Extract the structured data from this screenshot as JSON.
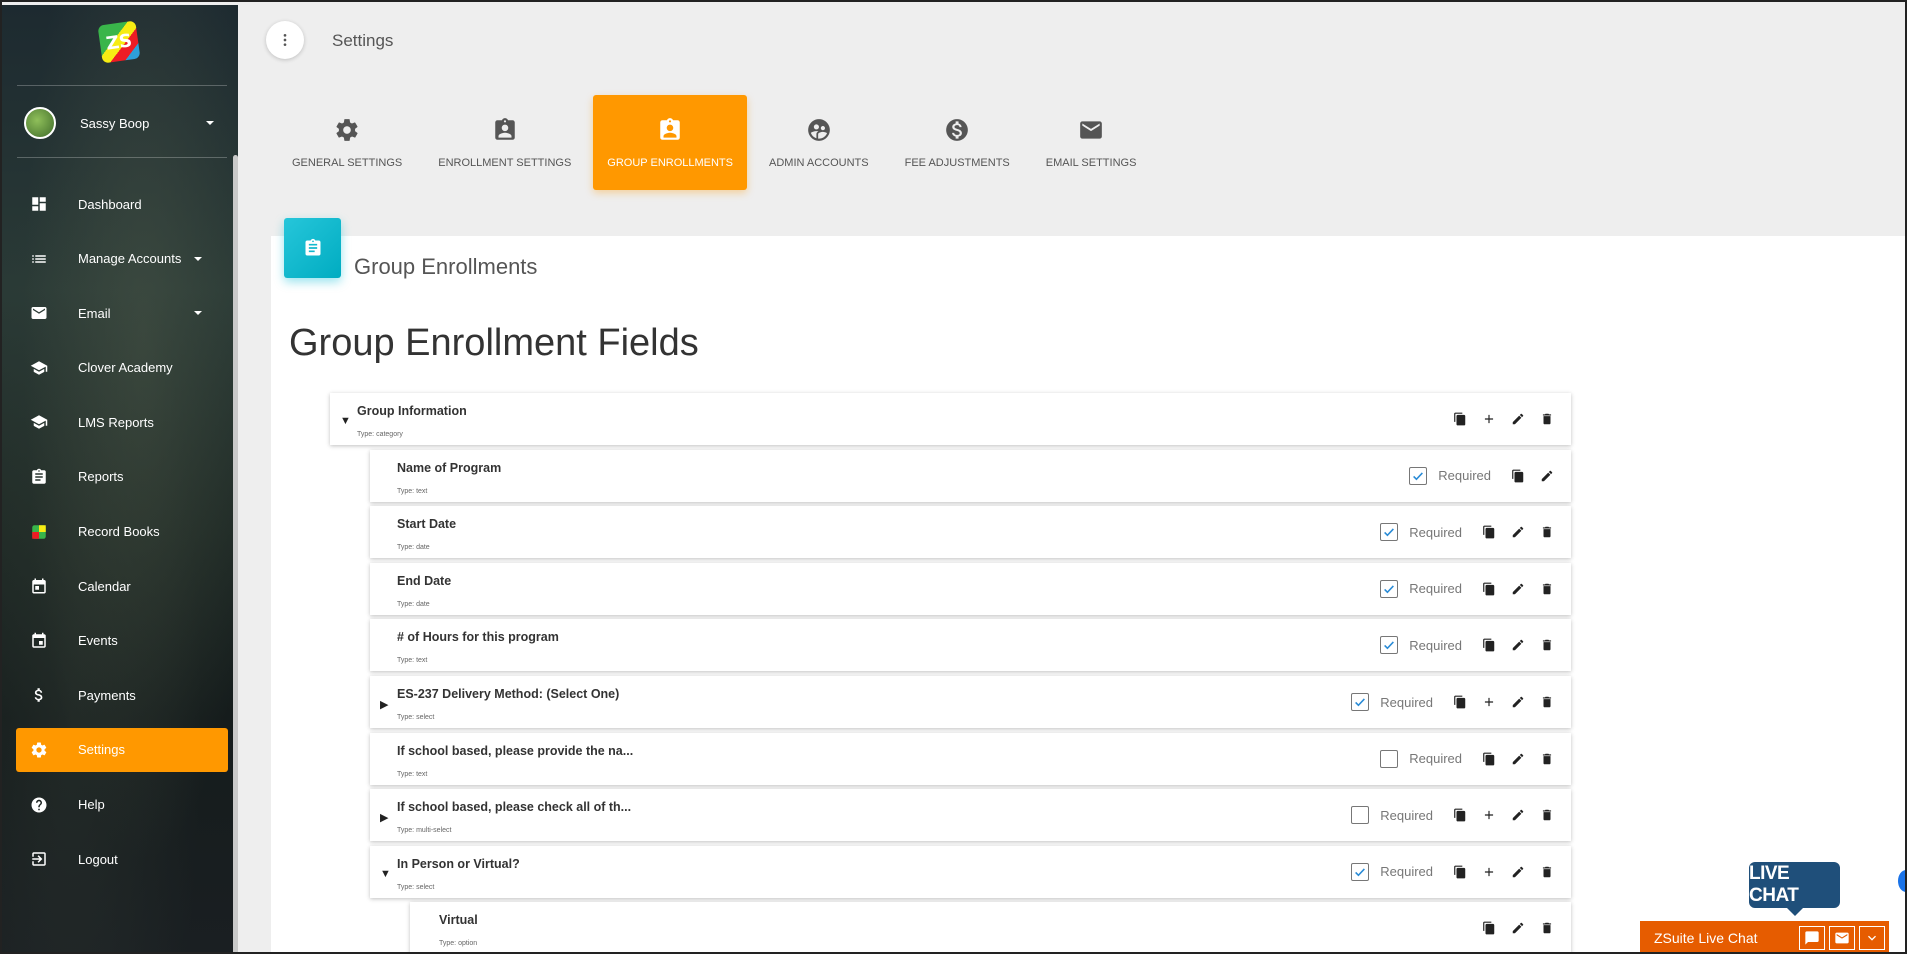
{
  "sidebar": {
    "logo_text": "ZS",
    "user_name": "Sassy Boop",
    "items": [
      {
        "label": "Dashboard",
        "icon": "dashboard-icon",
        "caret": false,
        "active": false
      },
      {
        "label": "Manage Accounts",
        "icon": "list-icon",
        "caret": true,
        "active": false
      },
      {
        "label": "Email",
        "icon": "mail-icon",
        "caret": true,
        "active": false
      },
      {
        "label": "Clover Academy",
        "icon": "school-icon",
        "caret": false,
        "active": false
      },
      {
        "label": "LMS Reports",
        "icon": "school-icon",
        "caret": false,
        "active": false
      },
      {
        "label": "Reports",
        "icon": "clipboard-icon",
        "caret": false,
        "active": false
      },
      {
        "label": "Record Books",
        "icon": "zs-logo-icon",
        "caret": false,
        "active": false
      },
      {
        "label": "Calendar",
        "icon": "calendar-icon",
        "caret": false,
        "active": false
      },
      {
        "label": "Events",
        "icon": "event-icon",
        "caret": false,
        "active": false
      },
      {
        "label": "Payments",
        "icon": "dollar-icon",
        "caret": false,
        "active": false
      },
      {
        "label": "Settings",
        "icon": "gear-icon",
        "caret": false,
        "active": true
      },
      {
        "label": "Help",
        "icon": "help-icon",
        "caret": false,
        "active": false
      },
      {
        "label": "Logout",
        "icon": "logout-icon",
        "caret": false,
        "active": false
      }
    ]
  },
  "header": {
    "title": "Settings",
    "tabs": [
      {
        "label": "GENERAL SETTINGS",
        "icon": "gear-icon",
        "active": false
      },
      {
        "label": "ENROLLMENT SETTINGS",
        "icon": "badge-icon",
        "active": false
      },
      {
        "label": "GROUP ENROLLMENTS",
        "icon": "badge-icon",
        "active": true
      },
      {
        "label": "ADMIN ACCOUNTS",
        "icon": "group-icon",
        "active": false
      },
      {
        "label": "FEE ADJUSTMENTS",
        "icon": "dollar-circle-icon",
        "active": false
      },
      {
        "label": "EMAIL SETTINGS",
        "icon": "mail-icon",
        "active": false
      }
    ]
  },
  "card": {
    "title": "Group Enrollments",
    "section_title": "Group Enrollment Fields"
  },
  "fields": [
    {
      "name": "Group Information",
      "type": "Type: category",
      "toggle": "down",
      "required": null,
      "actions": [
        "copy",
        "add",
        "edit",
        "delete"
      ],
      "level": 0
    },
    {
      "name": "Name of Program",
      "type": "Type: text",
      "toggle": null,
      "required": true,
      "actions": [
        "copy",
        "edit"
      ],
      "level": 1
    },
    {
      "name": "Start Date",
      "type": "Type: date",
      "toggle": null,
      "required": true,
      "actions": [
        "copy",
        "edit",
        "delete"
      ],
      "level": 1
    },
    {
      "name": "End Date",
      "type": "Type: date",
      "toggle": null,
      "required": true,
      "actions": [
        "copy",
        "edit",
        "delete"
      ],
      "level": 1
    },
    {
      "name": "# of Hours for this program",
      "type": "Type: text",
      "toggle": null,
      "required": true,
      "actions": [
        "copy",
        "edit",
        "delete"
      ],
      "level": 1
    },
    {
      "name": "ES-237 Delivery Method: (Select One)",
      "type": "Type: select",
      "toggle": "right",
      "required": true,
      "actions": [
        "copy",
        "add",
        "edit",
        "delete"
      ],
      "level": 1
    },
    {
      "name": "If school based, please provide the na...",
      "type": "Type: text",
      "toggle": null,
      "required": false,
      "actions": [
        "copy",
        "edit",
        "delete"
      ],
      "level": 1
    },
    {
      "name": "If school based, please check all of th...",
      "type": "Type: multi-select",
      "toggle": "right",
      "required": false,
      "actions": [
        "copy",
        "add",
        "edit",
        "delete"
      ],
      "level": 1
    },
    {
      "name": "In Person or Virtual?",
      "type": "Type: select",
      "toggle": "down",
      "required": true,
      "actions": [
        "copy",
        "add",
        "edit",
        "delete"
      ],
      "level": 1
    },
    {
      "name": "Virtual",
      "type": "Type: option",
      "toggle": null,
      "required": null,
      "actions": [
        "copy",
        "edit",
        "delete"
      ],
      "level": 2
    }
  ],
  "required_label": "Required",
  "live_chat": {
    "badge": "LIVE CHAT",
    "bar_label": "ZSuite Live Chat"
  },
  "colors": {
    "accent": "#ff9800",
    "card_icon": "#00bcd4",
    "chat_badge": "#1f4f7a",
    "chat_bar": "#e65c00"
  }
}
